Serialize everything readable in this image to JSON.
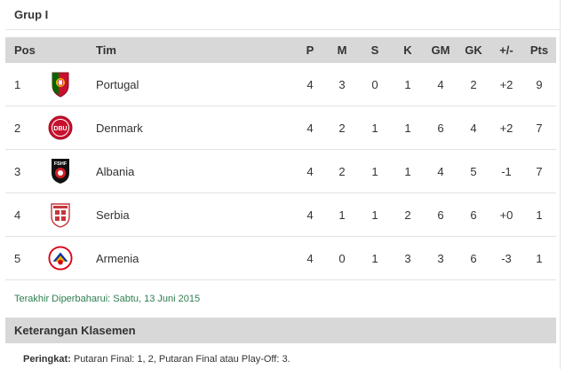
{
  "group_title": "Grup I",
  "table": {
    "headers": {
      "pos": "Pos",
      "team": "Tim",
      "played": "P",
      "won": "M",
      "drawn": "S",
      "lost": "K",
      "goals_for": "GM",
      "goals_against": "GK",
      "goal_diff": "+/-",
      "points": "Pts"
    },
    "rows": [
      {
        "pos": "1",
        "team": "Portugal",
        "crest": "portugal-crest-icon",
        "p": "4",
        "m": "3",
        "s": "0",
        "k": "1",
        "gm": "4",
        "gk": "2",
        "gd": "+2",
        "pts": "9"
      },
      {
        "pos": "2",
        "team": "Denmark",
        "crest": "denmark-crest-icon",
        "p": "4",
        "m": "2",
        "s": "1",
        "k": "1",
        "gm": "6",
        "gk": "4",
        "gd": "+2",
        "pts": "7"
      },
      {
        "pos": "3",
        "team": "Albania",
        "crest": "albania-crest-icon",
        "p": "4",
        "m": "2",
        "s": "1",
        "k": "1",
        "gm": "4",
        "gk": "5",
        "gd": "-1",
        "pts": "7"
      },
      {
        "pos": "4",
        "team": "Serbia",
        "crest": "serbia-crest-icon",
        "p": "4",
        "m": "1",
        "s": "1",
        "k": "2",
        "gm": "6",
        "gk": "6",
        "gd": "+0",
        "pts": "1"
      },
      {
        "pos": "5",
        "team": "Armenia",
        "crest": "armenia-crest-icon",
        "p": "4",
        "m": "0",
        "s": "1",
        "k": "3",
        "gm": "3",
        "gk": "6",
        "gd": "-3",
        "pts": "1"
      }
    ]
  },
  "crest_text": {
    "denmark": "DBU",
    "albania": "FSHF"
  },
  "last_updated": "Terakhir Diperbaharui: Sabtu, 13 Juni 2015",
  "legend": {
    "title": "Keterangan Klasemen",
    "label": "Peringkat:",
    "text": " Putaran Final: 1, 2, Putaran Final atau Play-Off: 3."
  },
  "colors": {
    "header_bg": "#d8d8d8",
    "updated_text": "#2e7d4f",
    "portugal_red": "#c8102e",
    "portugal_green": "#006600",
    "denmark_red": "#c8102e",
    "albania_black": "#111111",
    "albania_red": "#d21f26",
    "serbia_red": "#c6363c",
    "armenia_red": "#d90012",
    "armenia_blue": "#0033a0",
    "armenia_orange": "#f2a800"
  }
}
